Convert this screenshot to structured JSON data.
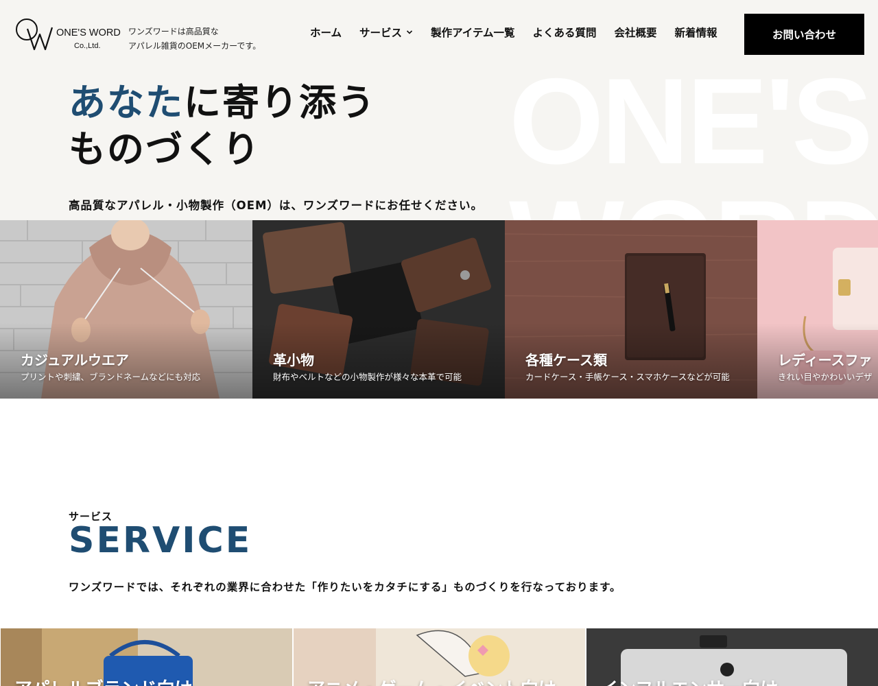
{
  "brand": {
    "name": "ONE'S WORD",
    "sub": "Co.,Ltd.",
    "monogram": "OW",
    "tagline_line1": "ワンズワードは高品質な",
    "tagline_line2": "アパレル雑貨のOEMメーカーです。"
  },
  "nav": {
    "items": [
      {
        "label": "ホーム"
      },
      {
        "label": "サービス",
        "has_dropdown": true
      },
      {
        "label": "製作アイテム一覧"
      },
      {
        "label": "よくある質問"
      },
      {
        "label": "会社概要"
      },
      {
        "label": "新着情報"
      }
    ],
    "contact_label": "お問い合わせ"
  },
  "hero": {
    "headline_accent": "あなた",
    "headline_rest": "に寄り添う",
    "headline_line2": "ものづくり",
    "lead": "高品質なアパレル・小物製作（OEM）は、ワンズワードにお任せください。",
    "watermark": "ONE'S\nWORD"
  },
  "categories": [
    {
      "title": "カジュアルウエア",
      "desc": "プリントや刺繍、ブランドネームなどにも対応"
    },
    {
      "title": "革小物",
      "desc": "財布やベルトなどの小物製作が様々な本革で可能"
    },
    {
      "title": "各種ケース類",
      "desc": "カードケース・手帳ケース・スマホケースなどが可能"
    },
    {
      "title": "レディースファ",
      "desc": "きれい目やかわいいデザ"
    }
  ],
  "service": {
    "kana": "サービス",
    "title": "SERVICE",
    "lead": "ワンズワードでは、それぞれの業界に合わせた「作りたいをカタチにする」ものづくりを行なっております。",
    "cards": [
      {
        "title": "アパレルブランド向け"
      },
      {
        "title": "アニメ・ゲーム・イベント向け"
      },
      {
        "title": "インフルエンサー向け"
      }
    ]
  },
  "colors": {
    "accent": "#1f4d72",
    "hero_bg": "#f6f5f2",
    "button_bg": "#000000"
  }
}
